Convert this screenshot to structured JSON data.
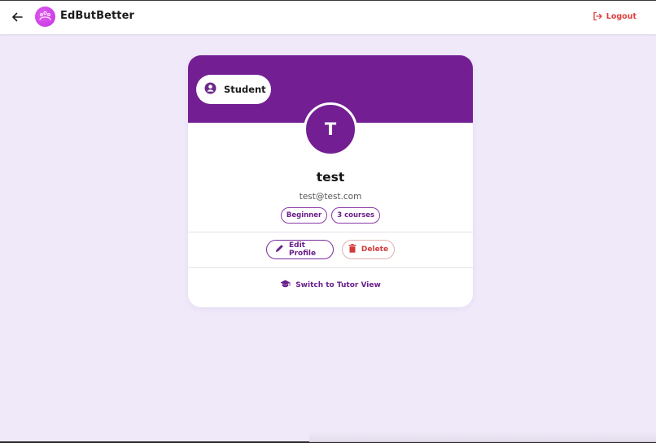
{
  "app": {
    "brand": "EdButBetter"
  },
  "header": {
    "logout_label": "Logout"
  },
  "profile": {
    "role": "Student",
    "avatar_initial": "T",
    "name": "test",
    "email": "test@test.com",
    "chips": [
      "Beginner",
      "3 courses"
    ],
    "edit_label": "Edit Profile",
    "delete_label": "Delete",
    "switch_label": "Switch to Tutor View"
  },
  "icons": {
    "back": "arrow-left-icon",
    "logo": "logo-icon",
    "logout": "logout-icon",
    "role": "account-circle-icon",
    "edit": "pencil-icon",
    "delete": "trash-icon",
    "switch": "graduation-cap-icon"
  },
  "colors": {
    "accent": "#731f93",
    "danger": "#d23a3a",
    "background": "#efe9fa"
  }
}
